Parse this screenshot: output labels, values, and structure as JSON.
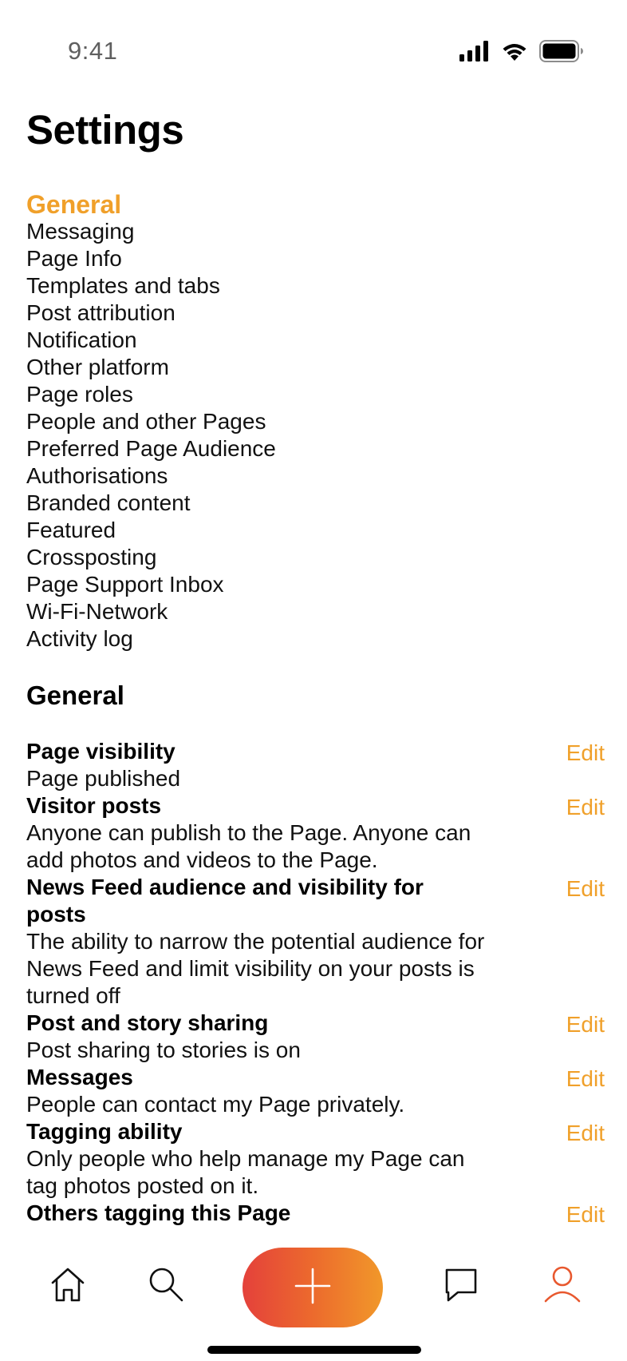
{
  "status_bar": {
    "time": "9:41"
  },
  "page_title": "Settings",
  "nav": {
    "items": [
      {
        "label": "General",
        "active": true
      },
      {
        "label": "Messaging"
      },
      {
        "label": "Page Info"
      },
      {
        "label": "Templates and tabs"
      },
      {
        "label": "Post attribution"
      },
      {
        "label": "Notification"
      },
      {
        "label": "Other platform"
      },
      {
        "label": "Page roles"
      },
      {
        "label": "People and other Pages"
      },
      {
        "label": "Preferred Page Audience"
      },
      {
        "label": "Authorisations"
      },
      {
        "label": "Branded content"
      },
      {
        "label": "Featured"
      },
      {
        "label": "Crossposting"
      },
      {
        "label": "Page Support Inbox"
      },
      {
        "label": "Wi-Fi-Network"
      },
      {
        "label": "Activity log"
      }
    ]
  },
  "section": {
    "title": "General",
    "edit_label": "Edit",
    "settings": [
      {
        "title": "Page visibility",
        "description": "Page published"
      },
      {
        "title": "Visitor posts",
        "description": "Anyone can publish to the Page. Anyone can add photos and videos to the Page."
      },
      {
        "title": "News Feed audience and visibility for posts",
        "description": "The ability to narrow the potential audience for News Feed and limit visibility on your posts is turned off"
      },
      {
        "title": "Post and story sharing",
        "description": "Post sharing to stories is on"
      },
      {
        "title": "Messages",
        "description": "People can contact my Page privately."
      },
      {
        "title": "Tagging ability",
        "description": "Only people who help manage my Page can tag photos posted on it."
      },
      {
        "title": "Others tagging this Page",
        "description": ""
      }
    ]
  },
  "tab_bar": {
    "tabs": [
      {
        "icon": "home-icon"
      },
      {
        "icon": "search-icon"
      },
      {
        "icon": "plus-icon"
      },
      {
        "icon": "chat-icon"
      },
      {
        "icon": "profile-icon",
        "active": true
      }
    ]
  },
  "colors": {
    "accent": "#f0a02a",
    "gradient_start": "#e4413b",
    "gradient_end": "#f1982a",
    "active_tab": "#e8582e"
  }
}
